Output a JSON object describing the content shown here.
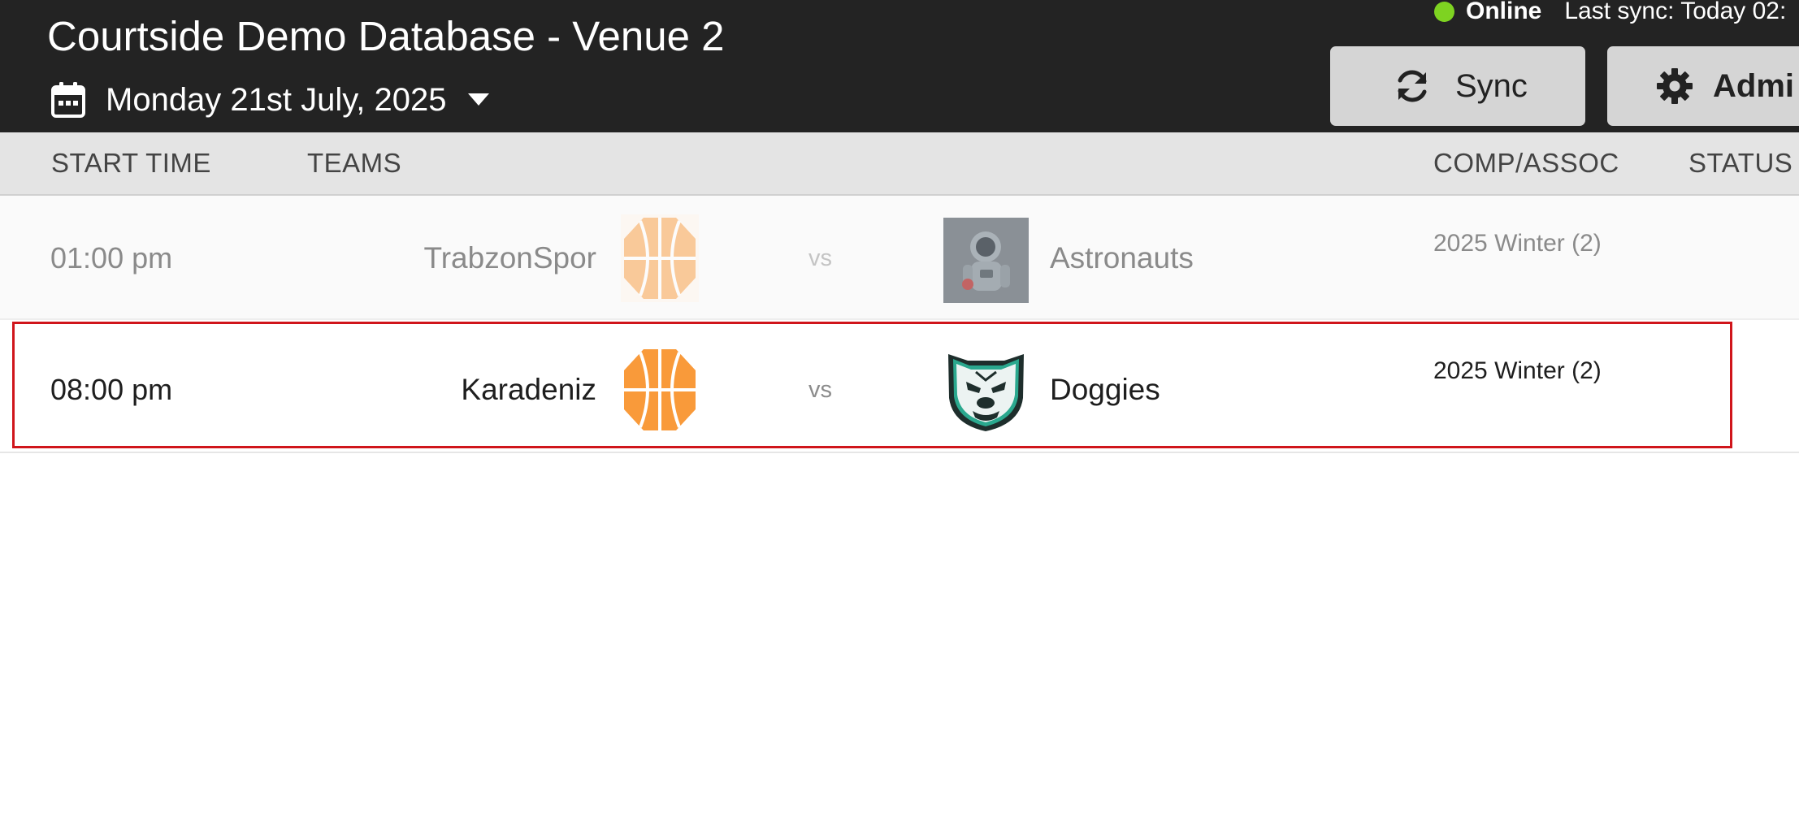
{
  "header": {
    "title": "Courtside Demo Database - Venue 2",
    "date": "Monday 21st July, 2025",
    "connection_status": "Online",
    "last_sync": "Last sync: Today 02:",
    "sync_button": "Sync",
    "admin_button": "Admi",
    "status_color": "#7ed321"
  },
  "columns": {
    "start_time": "START TIME",
    "teams": "TEAMS",
    "comp": "COMP/ASSOC",
    "status": "STATUS"
  },
  "matches": [
    {
      "start_time": "01:00 pm",
      "home_team": "TrabzonSpor",
      "vs": "vs",
      "away_team": "Astronauts",
      "comp": "2025 Winter (2)",
      "home_logo_icon": "basketball-icon",
      "away_logo_icon": "astronaut-icon"
    },
    {
      "start_time": "08:00 pm",
      "home_team": "Karadeniz",
      "vs": "vs",
      "away_team": "Doggies",
      "comp": "2025 Winter (2)",
      "home_logo_icon": "basketball-icon",
      "away_logo_icon": "bulldog-icon"
    }
  ],
  "colors": {
    "basketball": "#f99a3a",
    "selection": "#d0151b",
    "header_bg": "#232323"
  }
}
